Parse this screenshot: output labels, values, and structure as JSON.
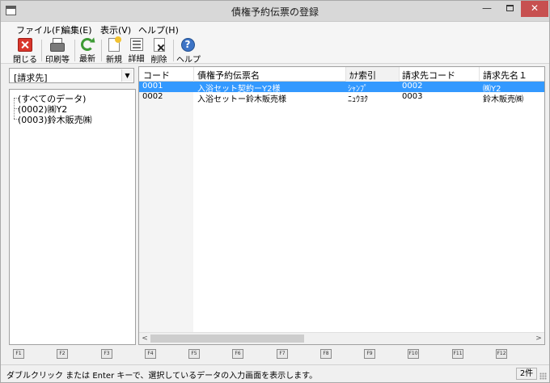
{
  "window": {
    "title": "債権予約伝票の登録",
    "minimize_glyph": "—",
    "close_glyph": "✕"
  },
  "menu": [
    "ファイル(F)",
    "編集(E)",
    "表示(V)",
    "ヘルプ(H)"
  ],
  "toolbar": [
    {
      "label": "閉じる",
      "icon": "close-icon"
    },
    {
      "label": "印刷等",
      "icon": "printer-icon"
    },
    {
      "label": "最新",
      "icon": "refresh-icon"
    },
    {
      "label": "新規",
      "icon": "new-document-icon"
    },
    {
      "label": "詳細",
      "icon": "detail-icon"
    },
    {
      "label": "削除",
      "icon": "delete-icon"
    },
    {
      "label": "ヘルプ",
      "icon": "help-icon"
    }
  ],
  "filter": {
    "selected": "[請求先]",
    "arrow": "▼"
  },
  "tree": [
    {
      "label": "(すべてのデータ)"
    },
    {
      "label": "(0002)㈱Y2"
    },
    {
      "label": "(0003)鈴木販売㈱"
    }
  ],
  "grid": {
    "columns": [
      "コード",
      "債権予約伝票名",
      "ｶﾅ索引",
      "請求先コード",
      "請求先名１"
    ],
    "rows": [
      {
        "code": "0001",
        "name": "入浴セット契約ーY2様",
        "kana": "ｼｬﾝﾌﾟ",
        "bill_code": "0002",
        "bill_name": "㈱Y2",
        "selected": true
      },
      {
        "code": "0002",
        "name": "入浴セットー鈴木販売様",
        "kana": "ﾆｭｳﾖｸ",
        "bill_code": "0003",
        "bill_name": "鈴木販売㈱",
        "selected": false
      }
    ],
    "scroll_left": "<",
    "scroll_right": ">"
  },
  "function_keys": [
    "F1",
    "F2",
    "F3",
    "F4",
    "F5",
    "F6",
    "F7",
    "F8",
    "F9",
    "F10",
    "F11",
    "F12"
  ],
  "status": {
    "message": "ダブルクリック または Enter キーで、選択しているデータの入力画面を表示します。",
    "count": "2件"
  },
  "colors": {
    "selection": "#3399ff",
    "close_button": "#c75050",
    "help_icon": "#3d74c6"
  }
}
